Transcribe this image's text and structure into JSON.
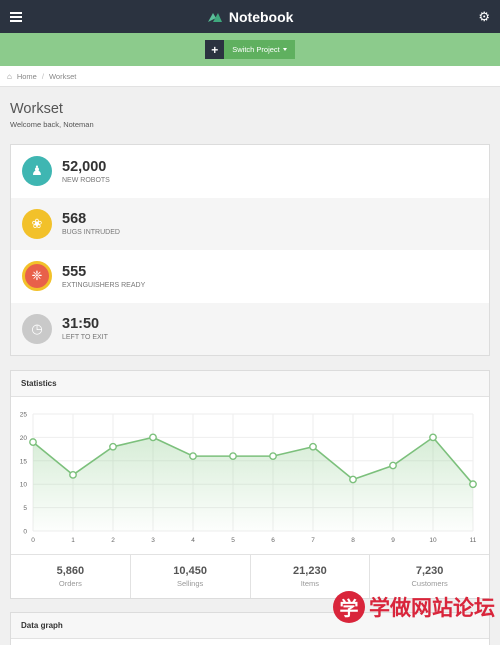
{
  "app": {
    "brand": "Notebook"
  },
  "header": {
    "switch_project_label": "Switch Project",
    "add_label": "+"
  },
  "breadcrumb": {
    "home": "Home",
    "current": "Workset"
  },
  "page": {
    "title": "Workset",
    "subtitle": "Welcome back, Noteman"
  },
  "stats": [
    {
      "value": "52,000",
      "label": "NEW ROBOTS",
      "icon": "robot-icon",
      "color": "#3fb6b2",
      "glyph": "♟"
    },
    {
      "value": "568",
      "label": "BUGS INTRUDED",
      "icon": "bug-icon",
      "color": "#f2c12a",
      "glyph": "❀"
    },
    {
      "value": "555",
      "label": "EXTINGUISHERS READY",
      "icon": "fire-extinguisher-icon",
      "color": "#e8604a",
      "glyph": "❈"
    },
    {
      "value": "31:50",
      "label": "LEFT TO EXIT",
      "icon": "clock-icon",
      "color": "#c9c9c9",
      "glyph": "◷"
    }
  ],
  "statistics": {
    "title": "Statistics",
    "summary": [
      {
        "value": "5,860",
        "label": "Orders"
      },
      {
        "value": "10,450",
        "label": "Sellings"
      },
      {
        "value": "21,230",
        "label": "Items"
      },
      {
        "value": "7,230",
        "label": "Customers"
      }
    ]
  },
  "data_graph": {
    "title": "Data graph"
  },
  "watermark": {
    "badge": "学",
    "text": "学做网站论坛"
  },
  "colors": {
    "topbar": "#2b3340",
    "green": "#8ccb8c",
    "line": "#7cc07c"
  },
  "chart_data": {
    "type": "area",
    "x": [
      0,
      1,
      2,
      3,
      4,
      5,
      6,
      7,
      8,
      9,
      10,
      11
    ],
    "series": [
      {
        "values": [
          19,
          12,
          18,
          20,
          16,
          16,
          16,
          18,
          11,
          14,
          20,
          10
        ]
      }
    ],
    "xlim": [
      0,
      11
    ],
    "ylim": [
      0,
      25
    ],
    "yticks": [
      0,
      5,
      10,
      15,
      20,
      25
    ],
    "grid": true,
    "title": "",
    "xlabel": "",
    "ylabel": ""
  }
}
